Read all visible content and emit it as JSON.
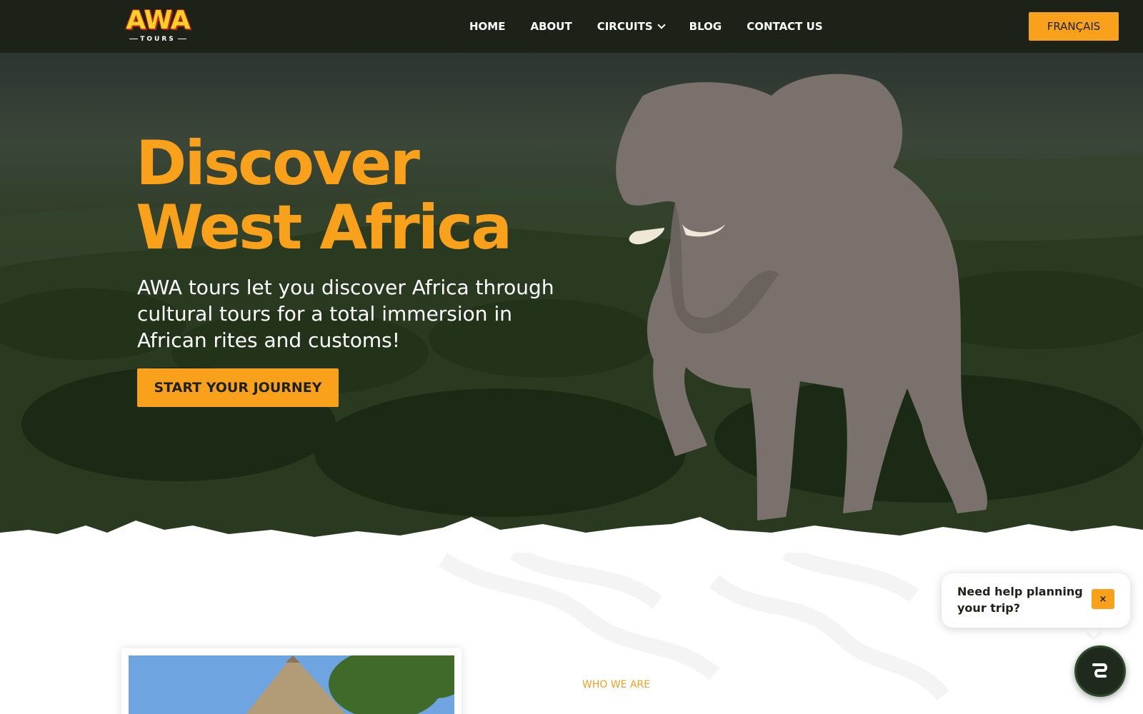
{
  "brand": {
    "logo_text": "AWA",
    "logo_sub": "TOURS"
  },
  "nav": {
    "items": [
      {
        "label": "HOME"
      },
      {
        "label": "ABOUT"
      },
      {
        "label": "CIRCUITS"
      },
      {
        "label": "BLOG"
      },
      {
        "label": "CONTACT US"
      }
    ],
    "language_button": "FRANÇAIS"
  },
  "hero": {
    "title_line1": "Discover",
    "title_line2": "West Africa",
    "subtitle": "AWA tours let you discover Africa through cultural tours for a total immersion in African rites and customs!",
    "cta": "START YOUR JOURNEY"
  },
  "about": {
    "eyebrow": "WHO WE ARE"
  },
  "chat": {
    "prompt": "Need help planning your trip?",
    "close": "×"
  },
  "colors": {
    "accent": "#f9a11b",
    "nav_bg": "#1c2218",
    "eyebrow": "#f0a020"
  },
  "icons": {
    "dropdown": "chevron-down-icon",
    "chat": "chat-launcher-icon"
  }
}
